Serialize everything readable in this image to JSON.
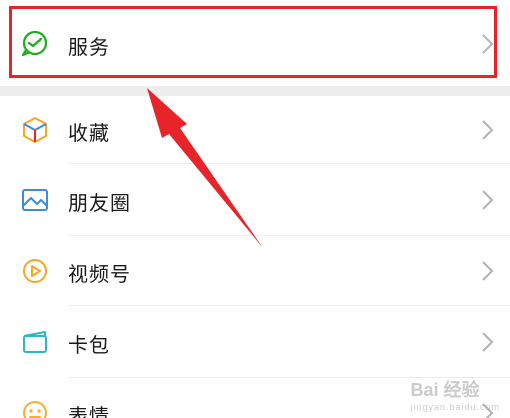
{
  "menu": {
    "service": {
      "label": "服务",
      "icon": "wechat-pay-icon"
    },
    "items": [
      {
        "label": "收藏",
        "icon": "favorites-cube-icon"
      },
      {
        "label": "朋友圈",
        "icon": "moments-photo-icon"
      },
      {
        "label": "视频号",
        "icon": "channels-play-icon"
      },
      {
        "label": "卡包",
        "icon": "card-wallet-icon"
      },
      {
        "label": "表情",
        "icon": "sticker-face-icon"
      }
    ]
  },
  "watermark": {
    "text": "Bai 经验",
    "sub": "jingyan.baidu.com"
  },
  "colors": {
    "highlight": "#e8242b",
    "green": "#1aad19",
    "orange": "#f5a623",
    "blue": "#3d8bd9",
    "teal": "#2bb7c4",
    "yellow": "#f3b12d"
  }
}
